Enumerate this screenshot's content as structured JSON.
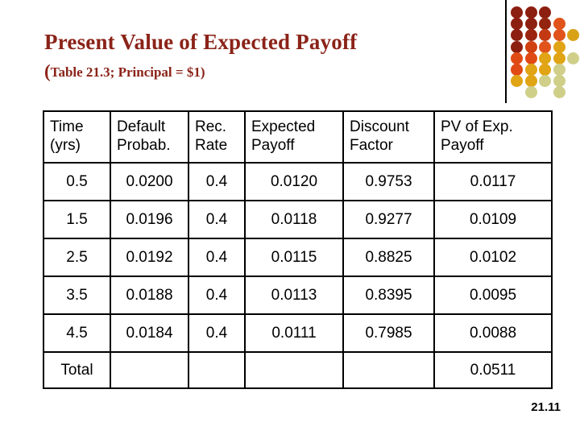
{
  "slide": {
    "title": "Present Value of Expected Payoff",
    "subtitle_paren_open": "(",
    "subtitle": "Table 21.3; Principal = $1)",
    "slide_number": "21.11",
    "title_color": "#8B2318",
    "decoration": {
      "name": "dot-grid",
      "colors": {
        "dark_maroon": "#8C1F10",
        "maroon": "#9B2410",
        "red_orange": "#E04A14",
        "orange": "#E06A10",
        "gold": "#D9A川",
        "amber": "#E0A414",
        "pale_gold": "#D9C878",
        "pale_green_gold": "#CFCF8A"
      },
      "dots": [
        {
          "row": 0,
          "col": 0,
          "color": "#8C1F10"
        },
        {
          "row": 0,
          "col": 1,
          "color": "#8C1F10"
        },
        {
          "row": 0,
          "col": 2,
          "color": "#8C1F10"
        },
        {
          "row": 1,
          "col": 0,
          "color": "#8C1F10"
        },
        {
          "row": 1,
          "col": 1,
          "color": "#8C1F10"
        },
        {
          "row": 1,
          "col": 2,
          "color": "#93240F"
        },
        {
          "row": 1,
          "col": 3,
          "color": "#E0531A"
        },
        {
          "row": 2,
          "col": 0,
          "color": "#8C1F10"
        },
        {
          "row": 2,
          "col": 1,
          "color": "#9B2410"
        },
        {
          "row": 2,
          "col": 2,
          "color": "#C33A12"
        },
        {
          "row": 2,
          "col": 3,
          "color": "#E0531A"
        },
        {
          "row": 2,
          "col": 4,
          "color": "#D9A216"
        },
        {
          "row": 3,
          "col": 0,
          "color": "#8C1F10"
        },
        {
          "row": 3,
          "col": 1,
          "color": "#D1400F"
        },
        {
          "row": 3,
          "col": 2,
          "color": "#E0531A"
        },
        {
          "row": 3,
          "col": 3,
          "color": "#E0A414"
        },
        {
          "row": 4,
          "col": 0,
          "color": "#E04A14"
        },
        {
          "row": 4,
          "col": 1,
          "color": "#E04A14"
        },
        {
          "row": 4,
          "col": 2,
          "color": "#E0A414"
        },
        {
          "row": 4,
          "col": 3,
          "color": "#E0A414"
        },
        {
          "row": 4,
          "col": 4,
          "color": "#CFCF8A"
        },
        {
          "row": 5,
          "col": 0,
          "color": "#E04A14"
        },
        {
          "row": 5,
          "col": 1,
          "color": "#E0A414"
        },
        {
          "row": 5,
          "col": 2,
          "color": "#E0A414"
        },
        {
          "row": 5,
          "col": 3,
          "color": "#CFCF8A"
        },
        {
          "row": 6,
          "col": 0,
          "color": "#E0A414"
        },
        {
          "row": 6,
          "col": 1,
          "color": "#E0A414"
        },
        {
          "row": 6,
          "col": 2,
          "color": "#CFCF8A"
        },
        {
          "row": 6,
          "col": 3,
          "color": "#CFCF8A"
        },
        {
          "row": 7,
          "col": 1,
          "color": "#CFCF8A"
        },
        {
          "row": 7,
          "col": 3,
          "color": "#CFCF8A"
        }
      ]
    }
  },
  "chart_data": {
    "type": "table",
    "title": "Present Value of Expected Payoff",
    "subtitle": "(Table 21.3; Principal = $1)",
    "columns": [
      "Time\n(yrs)",
      "Default\nProbab.",
      "Rec.\nRate",
      "Expected\nPayoff",
      "Discount\nFactor",
      "PV of Exp.\nPayoff"
    ],
    "rows": [
      [
        "0.5",
        "0.0200",
        "0.4",
        "0.0120",
        "0.9753",
        "0.0117"
      ],
      [
        "1.5",
        "0.0196",
        "0.4",
        "0.0118",
        "0.9277",
        "0.0109"
      ],
      [
        "2.5",
        "0.0192",
        "0.4",
        "0.0115",
        "0.8825",
        "0.0102"
      ],
      [
        "3.5",
        "0.0188",
        "0.4",
        "0.0113",
        "0.8395",
        "0.0095"
      ],
      [
        "4.5",
        "0.0184",
        "0.4",
        "0.0111",
        "0.7985",
        "0.0088"
      ]
    ],
    "total_row": [
      "Total",
      "",
      "",
      "",
      "",
      "0.0511"
    ],
    "x": [
      "0.5",
      "1.5",
      "2.5",
      "3.5",
      "4.5"
    ],
    "series": [
      {
        "name": "Default Probab.",
        "values": [
          0.02,
          0.0196,
          0.0192,
          0.0188,
          0.0184
        ]
      },
      {
        "name": "Rec. Rate",
        "values": [
          0.4,
          0.4,
          0.4,
          0.4,
          0.4
        ]
      },
      {
        "name": "Expected Payoff",
        "values": [
          0.012,
          0.0118,
          0.0115,
          0.0113,
          0.0111
        ]
      },
      {
        "name": "Discount Factor",
        "values": [
          0.9753,
          0.9277,
          0.8825,
          0.8395,
          0.7985
        ]
      },
      {
        "name": "PV of Exp. Payoff",
        "values": [
          0.0117,
          0.0109,
          0.0102,
          0.0095,
          0.0088
        ]
      }
    ],
    "total": 0.0511
  }
}
